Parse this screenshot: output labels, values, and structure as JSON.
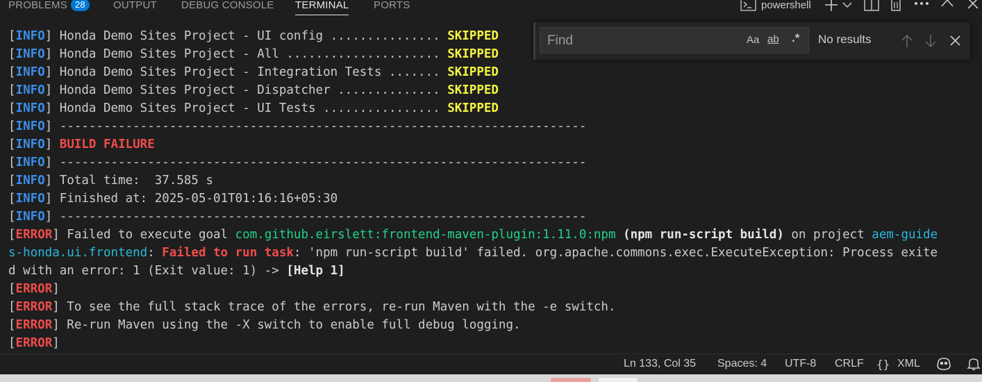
{
  "panel": {
    "tabs": [
      {
        "label": "PROBLEMS",
        "badge": "28"
      },
      {
        "label": "OUTPUT"
      },
      {
        "label": "DEBUG CONSOLE"
      },
      {
        "label": "TERMINAL"
      },
      {
        "label": "PORTS"
      }
    ],
    "active_tab": "TERMINAL",
    "terminal_name": "powershell"
  },
  "find": {
    "placeholder": "Find",
    "value": "",
    "match_case_label": "Aa",
    "whole_word_label": "ab",
    "regex_label": ".*",
    "result_text": "No results"
  },
  "terminal": {
    "lines": [
      [
        {
          "t": "[",
          "c": "br"
        },
        {
          "t": "INFO",
          "c": "info"
        },
        {
          "t": "] Honda Demo Sites Project - UI config ............... ",
          "c": ""
        },
        {
          "t": "SKIPPED",
          "c": "skip"
        }
      ],
      [
        {
          "t": "[",
          "c": "br"
        },
        {
          "t": "INFO",
          "c": "info"
        },
        {
          "t": "] Honda Demo Sites Project - All ..................... ",
          "c": ""
        },
        {
          "t": "SKIPPED",
          "c": "skip"
        }
      ],
      [
        {
          "t": "[",
          "c": "br"
        },
        {
          "t": "INFO",
          "c": "info"
        },
        {
          "t": "] Honda Demo Sites Project - Integration Tests ....... ",
          "c": ""
        },
        {
          "t": "SKIPPED",
          "c": "skip"
        }
      ],
      [
        {
          "t": "[",
          "c": "br"
        },
        {
          "t": "INFO",
          "c": "info"
        },
        {
          "t": "] Honda Demo Sites Project - Dispatcher .............. ",
          "c": ""
        },
        {
          "t": "SKIPPED",
          "c": "skip"
        }
      ],
      [
        {
          "t": "[",
          "c": "br"
        },
        {
          "t": "INFO",
          "c": "info"
        },
        {
          "t": "] Honda Demo Sites Project - UI Tests ................ ",
          "c": ""
        },
        {
          "t": "SKIPPED",
          "c": "skip"
        }
      ],
      [
        {
          "t": "[",
          "c": "br"
        },
        {
          "t": "INFO",
          "c": "info"
        },
        {
          "t": "] ------------------------------------------------------------------------",
          "c": ""
        }
      ],
      [
        {
          "t": "[",
          "c": "br"
        },
        {
          "t": "INFO",
          "c": "info"
        },
        {
          "t": "] ",
          "c": ""
        },
        {
          "t": "BUILD FAILURE",
          "c": "redb"
        }
      ],
      [
        {
          "t": "[",
          "c": "br"
        },
        {
          "t": "INFO",
          "c": "info"
        },
        {
          "t": "] ------------------------------------------------------------------------",
          "c": ""
        }
      ],
      [
        {
          "t": "[",
          "c": "br"
        },
        {
          "t": "INFO",
          "c": "info"
        },
        {
          "t": "] Total time:  37.585 s",
          "c": ""
        }
      ],
      [
        {
          "t": "[",
          "c": "br"
        },
        {
          "t": "INFO",
          "c": "info"
        },
        {
          "t": "] Finished at: 2025-05-01T01:16:16+05:30",
          "c": ""
        }
      ],
      [
        {
          "t": "[",
          "c": "br"
        },
        {
          "t": "INFO",
          "c": "info"
        },
        {
          "t": "] ------------------------------------------------------------------------",
          "c": ""
        }
      ],
      [
        {
          "t": "[",
          "c": "br"
        },
        {
          "t": "ERROR",
          "c": "err"
        },
        {
          "t": "] Failed to execute goal ",
          "c": ""
        },
        {
          "t": "com.github.eirslett:frontend-maven-plugin:1.11.0:npm",
          "c": "grn"
        },
        {
          "t": " ",
          "c": ""
        },
        {
          "t": "(npm run-script build)",
          "c": "bold"
        },
        {
          "t": " on project ",
          "c": ""
        },
        {
          "t": "aem-guide",
          "c": "cyan"
        }
      ],
      [
        {
          "t": "s-honda.ui.frontend",
          "c": "cyan"
        },
        {
          "t": ": ",
          "c": ""
        },
        {
          "t": "Failed to run task",
          "c": "redb"
        },
        {
          "t": ": 'npm run-script build' failed. org.apache.commons.exec.ExecuteException: Process exite",
          "c": ""
        }
      ],
      [
        {
          "t": "d with an error: 1 (Exit value: 1) -> ",
          "c": ""
        },
        {
          "t": "[Help 1]",
          "c": "bold"
        }
      ],
      [
        {
          "t": "[",
          "c": "br"
        },
        {
          "t": "ERROR",
          "c": "err"
        },
        {
          "t": "]",
          "c": ""
        }
      ],
      [
        {
          "t": "[",
          "c": "br"
        },
        {
          "t": "ERROR",
          "c": "err"
        },
        {
          "t": "] To see the full stack trace of the errors, re-run Maven with the -e switch.",
          "c": ""
        }
      ],
      [
        {
          "t": "[",
          "c": "br"
        },
        {
          "t": "ERROR",
          "c": "err"
        },
        {
          "t": "] Re-run Maven using the -X switch to enable full debug logging.",
          "c": ""
        }
      ],
      [
        {
          "t": "[",
          "c": "br"
        },
        {
          "t": "ERROR",
          "c": "err"
        },
        {
          "t": "]",
          "c": ""
        }
      ]
    ]
  },
  "statusbar": {
    "position": "Ln 133, Col 35",
    "spaces": "Spaces: 4",
    "encoding": "UTF-8",
    "eol": "CRLF",
    "language": "XML",
    "language_icon": "braces-icon"
  },
  "colors": {
    "background": "#1e1e1e",
    "info": "#3b8eea",
    "error": "#f14c4c",
    "skipped": "#f5f543",
    "plugin_green": "#23d18b",
    "project_cyan": "#29b8db",
    "badge": "#0078d4"
  }
}
